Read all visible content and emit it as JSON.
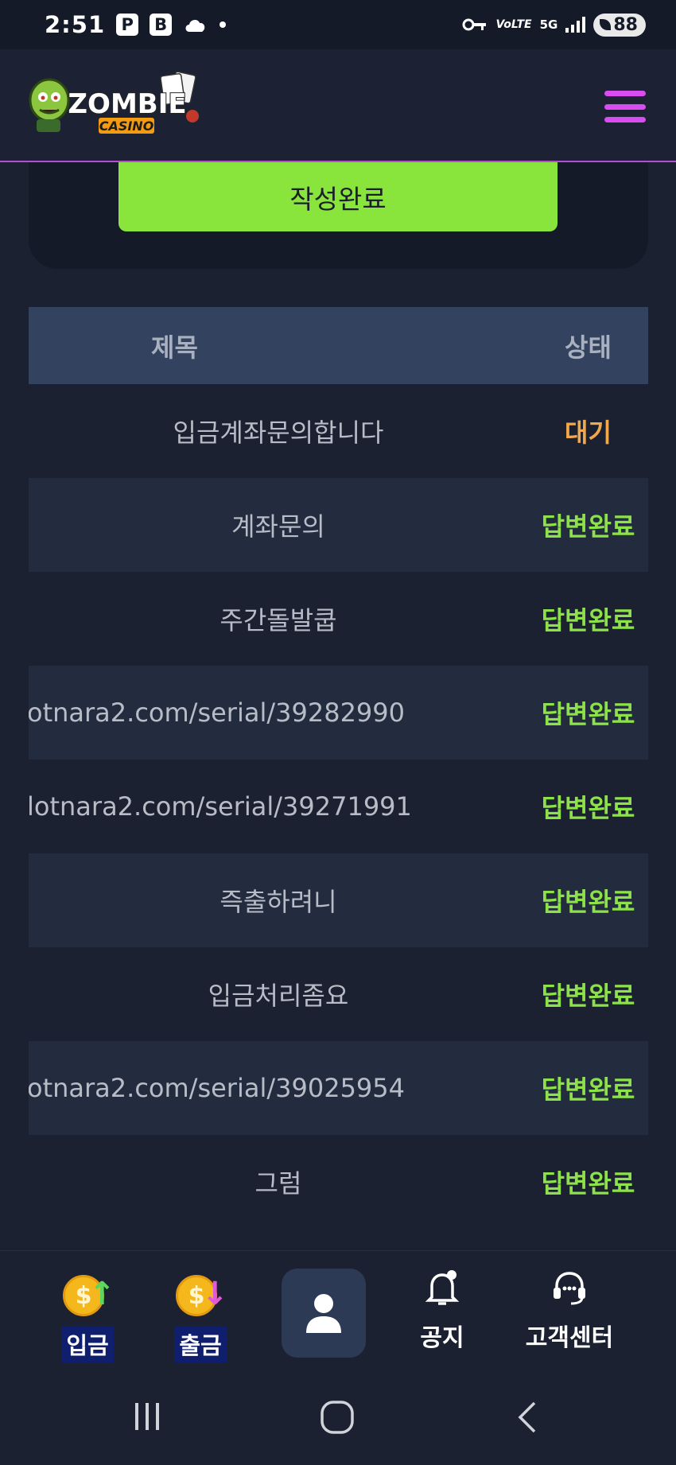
{
  "status_bar": {
    "time": "2:51",
    "app_icons": [
      "P",
      "B"
    ],
    "network": "5G",
    "volte": "VoLTE",
    "battery": "88"
  },
  "header": {
    "logo_main": "ZOMBIE",
    "logo_sub": "CASINO"
  },
  "form": {
    "submit_label": "작성완료"
  },
  "table": {
    "headers": {
      "title": "제목",
      "status": "상태"
    },
    "rows": [
      {
        "title": "입금계좌문의합니다",
        "status": "대기",
        "state": "wait"
      },
      {
        "title": "계좌문의",
        "status": "답변완료",
        "state": "done"
      },
      {
        "title": "주간돌발쿱",
        "status": "답변완료",
        "state": "done"
      },
      {
        "title": "otnara2.com/serial/39282990",
        "status": "답변완료",
        "state": "done"
      },
      {
        "title": "lotnara2.com/serial/39271991",
        "status": "답변완료",
        "state": "done"
      },
      {
        "title": "즉출하려니",
        "status": "답변완료",
        "state": "done"
      },
      {
        "title": "입금처리좀요",
        "status": "답변완료",
        "state": "done"
      },
      {
        "title": "otnara2.com/serial/39025954",
        "status": "답변완료",
        "state": "done"
      },
      {
        "title": "그럼",
        "status": "답변완료",
        "state": "done"
      }
    ]
  },
  "bottom_nav": {
    "deposit": "입금",
    "withdraw": "출금",
    "notice": "공지",
    "support": "고객센터"
  },
  "colors": {
    "background": "#1b2131",
    "header_accent": "#b44ed6",
    "submit_green": "#89e43c",
    "status_wait": "#f2a94b",
    "status_done": "#8ee249"
  }
}
